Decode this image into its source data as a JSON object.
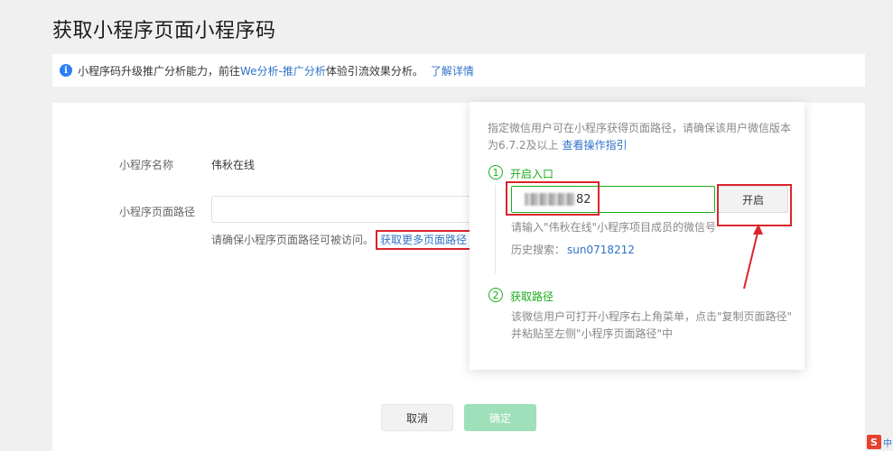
{
  "page": {
    "title": "获取小程序页面小程序码"
  },
  "notice": {
    "icon": "info-icon",
    "text_before": "小程序码升级推广分析能力，前往",
    "link_main": "We分析-推广分析",
    "text_after": "体验引流效果分析。",
    "learn_more": "了解详情"
  },
  "form": {
    "name_label": "小程序名称",
    "name_value": "伟秋在线",
    "path_label": "小程序页面路径",
    "path_value": "",
    "path_hint": "请确保小程序页面路径可被访问。",
    "more_link": "获取更多页面路径"
  },
  "buttons": {
    "cancel": "取消",
    "confirm": "确定"
  },
  "popover": {
    "intro": "指定微信用户可在小程序获得页面路径，请确保该用户微信版本为6.7.2及以上",
    "guide_link": "查看操作指引",
    "step1": {
      "number": "1",
      "title": "开启入口",
      "input_visible_suffix": "82",
      "open_button": "开启",
      "input_hint": "请输入\"伟秋在线\"小程序项目成员的微信号",
      "history_label": "历史搜索：",
      "history_value": "sun0718212"
    },
    "step2": {
      "number": "2",
      "title": "获取路径",
      "desc_line1": "该微信用户可打开小程序右上角菜单，点击\"复制页面路径\"",
      "desc_line2": "并粘贴至左侧\"小程序页面路径\"中"
    }
  },
  "colors": {
    "accent_green": "#1aad19",
    "link_blue": "#2f73c9",
    "annotation_red": "#d9262c",
    "confirm_disabled": "#9de0b9"
  },
  "corner_logo": {
    "letter": "S",
    "text": "中"
  }
}
